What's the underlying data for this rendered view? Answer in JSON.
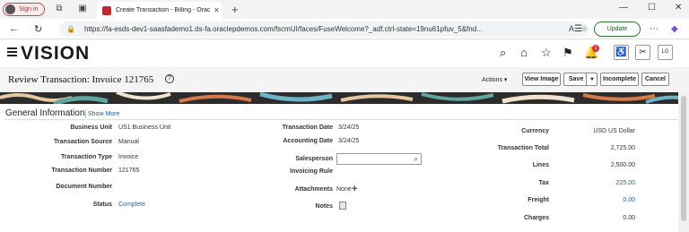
{
  "browser": {
    "signin_label": "Sign in",
    "tab_title": "Create Transaction - Billing - Orac",
    "url": "https://fa-esds-dev1-saasfademo1.ds-fa.oraclepdemos.com/fscmUI/faces/FuseWelcome?_adf.ctrl-state=19nu61pfuv_5&fnd...",
    "update_label": "Update"
  },
  "app": {
    "brand": "VISION",
    "notification_count": "1",
    "user_initials": "LG"
  },
  "page": {
    "title": "Review Transaction: Invoice 121765",
    "actions_label": "Actions ▾",
    "buttons": {
      "view_image": "View Image",
      "save": "Save",
      "incomplete": "Incomplete",
      "cancel": "Cancel"
    }
  },
  "general": {
    "heading": "General Information",
    "show_more": "Show More",
    "left": {
      "business_unit_label": "Business Unit",
      "business_unit": "US1 Business Unit",
      "transaction_source_label": "Transaction Source",
      "transaction_source": "Manual",
      "transaction_type_label": "Transaction Type",
      "transaction_type": "Invoice",
      "transaction_number_label": "Transaction Number",
      "transaction_number": "121765",
      "document_number_label": "Document Number",
      "status_label": "Status",
      "status": "Complete"
    },
    "middle": {
      "transaction_date_label": "Transaction Date",
      "transaction_date": "3/24/25",
      "accounting_date_label": "Accounting Date",
      "accounting_date": "3/24/25",
      "salesperson_label": "Salesperson",
      "invoicing_rule_label": "Invoicing Rule",
      "attachments_label": "Attachments",
      "attachments": "None",
      "notes_label": "Notes"
    },
    "right": {
      "currency_label": "Currency",
      "currency": "USD US Dollar",
      "transaction_total_label": "Transaction Total",
      "transaction_total": "2,725.00",
      "lines_label": "Lines",
      "lines": "2,500.00",
      "tax_label": "Tax",
      "tax": "225.00",
      "freight_label": "Freight",
      "freight": "0.00",
      "charges_label": "Charges",
      "charges": "0.00"
    }
  }
}
